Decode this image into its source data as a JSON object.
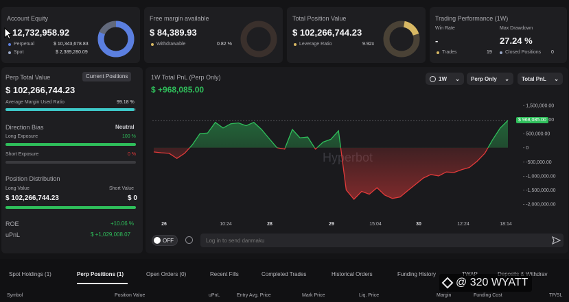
{
  "account_equity": {
    "label": "Account Equity",
    "value": "12,732,958.92",
    "perpetual_label": "Perpetual",
    "perpetual_value": "$ 10,343,678.83",
    "spot_label": "Spot",
    "spot_value": "$ 2,389,280.09",
    "perpetual_share": 0.8123
  },
  "free_margin": {
    "label": "Free margin available",
    "value": "$ 84,389.93",
    "withdrawable_label": "Withdrawable",
    "withdrawable_value": "0.82 %"
  },
  "total_position": {
    "label": "Total Position Value",
    "value": "$ 102,266,744.23",
    "leverage_label": "Leverage Ratio",
    "leverage_value": "9.92x"
  },
  "trading_performance": {
    "label": "Trading Performance (1W)",
    "win_rate_label": "Win Rate",
    "win_rate_value": "-",
    "max_drawdown_label": "Max Drawdown",
    "max_drawdown_value": "27.24 %",
    "trades_label": "Trades",
    "trades_value": "19",
    "closed_label": "Closed Positions",
    "closed_value": "0"
  },
  "perp_panel": {
    "title": "Perp Total Value",
    "current_positions_btn": "Current Positions",
    "value": "$ 102,266,744.23",
    "margin_label": "Average Margin Used Ratio",
    "margin_value": "99.18 %",
    "margin_fraction": 0.9918,
    "direction_label": "Direction Bias",
    "direction_value": "Neutral",
    "long_label": "Long Exposure",
    "long_value": "100 %",
    "long_fraction": 1.0,
    "short_label": "Short Exposure",
    "short_value": "0 %",
    "short_fraction": 0.0,
    "distribution_label": "Position Distribution",
    "long_value_label": "Long Value",
    "short_value_label": "Short Value",
    "long_amount": "$ 102,266,744.23",
    "short_amount": "$ 0",
    "roe_label": "ROE",
    "roe_value": "+10.06 %",
    "upnl_label": "uPnL",
    "upnl_value": "$ +1,029,008.07"
  },
  "pnl_chart_header": {
    "title": "1W Total PnL (Perp Only)",
    "value": "$ +968,085.00",
    "period": "1W",
    "mode": "Perp Only",
    "metric": "Total PnL",
    "watermark": "Hyperbot"
  },
  "chart_data": {
    "type": "area",
    "ylim": [
      -2000000,
      1500000
    ],
    "yticks": [
      "1,500,000.00",
      "1,000,000.00",
      "500,000.00",
      "0",
      "-500,000.00",
      "-1,000,000.00",
      "-1,500,000.00",
      "-2,000,000.00"
    ],
    "xticks": [
      "26",
      "10:24",
      "28",
      "29",
      "15:04",
      "30",
      "12:24",
      "18:14"
    ],
    "last_value_label": "$ 968,085.00",
    "series": [
      {
        "x": [
          0,
          1,
          2,
          3,
          4,
          5,
          6,
          7,
          8,
          9,
          10,
          11,
          12,
          13,
          14,
          15,
          16,
          17,
          18,
          19,
          20,
          21,
          22,
          23,
          24,
          25,
          26,
          27,
          28,
          29,
          30,
          31,
          32,
          33,
          34,
          35,
          36,
          37,
          38,
          39,
          40,
          41,
          42,
          43,
          44,
          45,
          46
        ],
        "values": [
          -150000,
          -180000,
          -200000,
          -380000,
          -200000,
          100000,
          500000,
          520000,
          900000,
          700000,
          850000,
          880000,
          780000,
          900000,
          650000,
          320000,
          0,
          -50000,
          650000,
          350000,
          380000,
          -50000,
          200000,
          300000,
          600000,
          -1500000,
          -1830000,
          -1550000,
          -1650000,
          -1420000,
          -1680000,
          -1800000,
          -1750000,
          -1520000,
          -1300000,
          -1080000,
          -950000,
          -1000000,
          -860000,
          -880000,
          -780000,
          -700000,
          -480000,
          -200000,
          280000,
          700000,
          968085
        ]
      }
    ]
  },
  "chat": {
    "toggle": "OFF",
    "placeholder": "Log in to send danmaku"
  },
  "tabs": [
    "Spot Holdings (1)",
    "Perp Positions (1)",
    "Open Orders (0)",
    "Recent Fills",
    "Completed Trades",
    "Historical Orders",
    "Funding History",
    "TWAP",
    "Deposits & Withdrav"
  ],
  "table_headers": {
    "symbol": "Symbol",
    "position_value": "Position Value",
    "upnl": "uPnL",
    "entry": "Entry Avg. Price",
    "mark": "Mark Price",
    "liq": "Liq. Price",
    "margin": "Margin",
    "funding": "Funding Cost",
    "tpsl": "TP/SL"
  },
  "watermark_overlay": "@ 320 WYATT",
  "colors": {
    "green": "#2fbf5b",
    "red": "#e23a3a",
    "accent_blue": "#5b7fe0",
    "teal": "#3ec9c9",
    "gold": "#d8b863"
  }
}
